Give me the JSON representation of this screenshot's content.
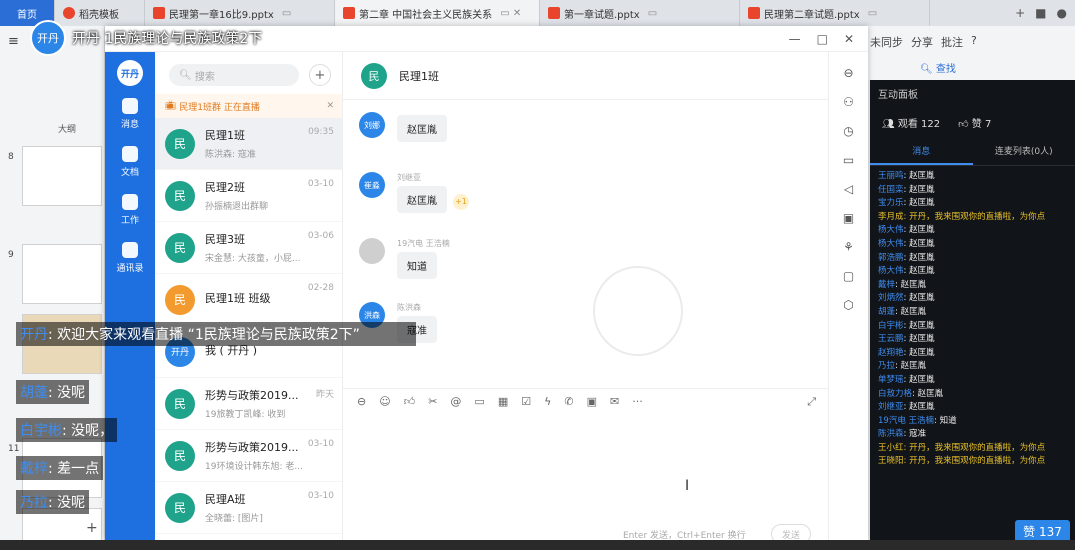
{
  "tabs": [
    {
      "label": "首页",
      "color": "#2b6fd6"
    },
    {
      "label": "稻壳模板",
      "color": "#e8452c"
    },
    {
      "label": "民理第一章16比9.pptx",
      "color": "#e8452c"
    },
    {
      "label": "第二章 中国社会主义民族关系",
      "color": "#e8452c"
    },
    {
      "label": "第一章试题.pptx",
      "color": "#e8452c"
    },
    {
      "label": "民理第二章试题.pptx",
      "color": "#e8452c"
    }
  ],
  "ppt_right": {
    "sync": "未同步",
    "share": "分享",
    "annotate": "批注",
    "find": "查找"
  },
  "ppt_left": {
    "outline": "大纲",
    "slide_nums": [
      "8",
      "9",
      "10",
      "11"
    ]
  },
  "window": {
    "title": "开丹 1民族理论与民族政策2下"
  },
  "nav": {
    "avatar": "开丹",
    "items": [
      {
        "label": "消息",
        "icon": "chat-icon"
      },
      {
        "label": "文档",
        "icon": "doc-icon"
      },
      {
        "label": "工作",
        "icon": "apps-icon"
      },
      {
        "label": "通讯录",
        "icon": "contacts-icon"
      }
    ]
  },
  "list": {
    "search_placeholder": "搜索",
    "live_bar": "民理1班群 正在直播",
    "conversations": [
      {
        "avatar": "民",
        "name": "民理1班",
        "msg": "陈洪森: 寇准",
        "time": "09:35",
        "active": true
      },
      {
        "avatar": "民",
        "name": "民理2班",
        "msg": "孙振楠退出群聊",
        "time": "03-10",
        "active": false
      },
      {
        "avatar": "民",
        "name": "民理3班",
        "msg": "宋金慧: 大孩童，小屁...",
        "time": "03-06",
        "active": false
      },
      {
        "avatar": "民",
        "name": "民理1班 班级",
        "msg": "",
        "time": "02-28",
        "active": false
      },
      {
        "avatar": "开丹",
        "name": "我 ( 开丹 )",
        "msg": "",
        "time": "",
        "active": false
      },
      {
        "avatar": "民",
        "name": "形势与政策2019...",
        "msg": "19旅教丁凯峰: 收到",
        "time": "昨天",
        "active": false
      },
      {
        "avatar": "民",
        "name": "形势与政策2019...",
        "msg": "19环境设计韩东旭: 老...",
        "time": "03-10",
        "active": false
      },
      {
        "avatar": "民",
        "name": "民理A班",
        "msg": "全晓蕾: [图片]",
        "time": "03-10",
        "active": false
      }
    ]
  },
  "chat": {
    "header_avatar": "民",
    "header_name": "民理1班",
    "messages": [
      {
        "avatar": "刘娜",
        "sender": "",
        "text": "赵匡胤",
        "plus": ""
      },
      {
        "avatar": "崔淼",
        "sender": "刘继亚",
        "text": "赵匡胤",
        "plus": "+1"
      },
      {
        "avatar": "",
        "sender": "19汽电 王浩楠",
        "text": "知道",
        "plus": ""
      },
      {
        "avatar": "洪森",
        "sender": "陈洪森",
        "text": "寇准",
        "plus": ""
      }
    ],
    "hint": "Enter 发送，Ctrl+Enter 换行",
    "send": "发送"
  },
  "panel": {
    "title": "互动面板",
    "viewers": "观看 122",
    "likes": "赞 7",
    "tab_messages": "消息",
    "tab_mic": "连麦列表(0人)",
    "danmu": [
      {
        "n": "王丽鸣",
        "t": "赵匡胤",
        "y": false
      },
      {
        "n": "任国栾",
        "t": "赵匡胤",
        "y": false
      },
      {
        "n": "宝力乐",
        "t": "赵匡胤",
        "y": false
      },
      {
        "n": "李月成",
        "t": "开丹，我来围观你的直播啦，为你点",
        "y": true
      },
      {
        "n": "杨大伟",
        "t": "赵匡胤",
        "y": false
      },
      {
        "n": "杨大伟",
        "t": "赵匡胤",
        "y": false
      },
      {
        "n": "郭浩鹏",
        "t": "赵匡胤",
        "y": false
      },
      {
        "n": "杨大伟",
        "t": "赵匡胤",
        "y": false
      },
      {
        "n": "戴梓",
        "t": "赵匡胤",
        "y": false
      },
      {
        "n": "刘炳然",
        "t": "赵匡胤",
        "y": false
      },
      {
        "n": "胡蓬",
        "t": "赵匡胤",
        "y": false
      },
      {
        "n": "白宇彬",
        "t": "赵匡胤",
        "y": false
      },
      {
        "n": "王云鹏",
        "t": "赵匡胤",
        "y": false
      },
      {
        "n": "赵翔艳",
        "t": "赵匡胤",
        "y": false
      },
      {
        "n": "乃拉",
        "t": "赵匡胤",
        "y": false
      },
      {
        "n": "单梦瑶",
        "t": "赵匡胤",
        "y": false
      },
      {
        "n": "白敖力格",
        "t": "赵匡胤",
        "y": false
      },
      {
        "n": "刘继亚",
        "t": "赵匡胤",
        "y": false
      },
      {
        "n": "19汽电 王浩楠",
        "t": "知道",
        "y": false
      },
      {
        "n": "陈洪森",
        "t": "寇准",
        "y": false
      },
      {
        "n": "王小红",
        "t": "开丹，我来围观你的直播啦，为你点",
        "y": true
      },
      {
        "n": "王晓阳",
        "t": "开丹，我来围观你的直播啦，为你点",
        "y": true
      }
    ],
    "like_badge": "赞 137"
  },
  "overlay": {
    "avatar": "开丹",
    "lines": [
      {
        "name": "开丹",
        "text": ": 欢迎大家来观看直播 “1民族理论与民族政策2下”"
      },
      {
        "name": "胡蓬",
        "text": ": 没呢"
      },
      {
        "name": "白宇彬",
        "text": ": 没呢，"
      },
      {
        "name": "戴梓",
        "text": ": 差一点"
      },
      {
        "name": "乃拉",
        "text": ": 没呢"
      }
    ]
  }
}
